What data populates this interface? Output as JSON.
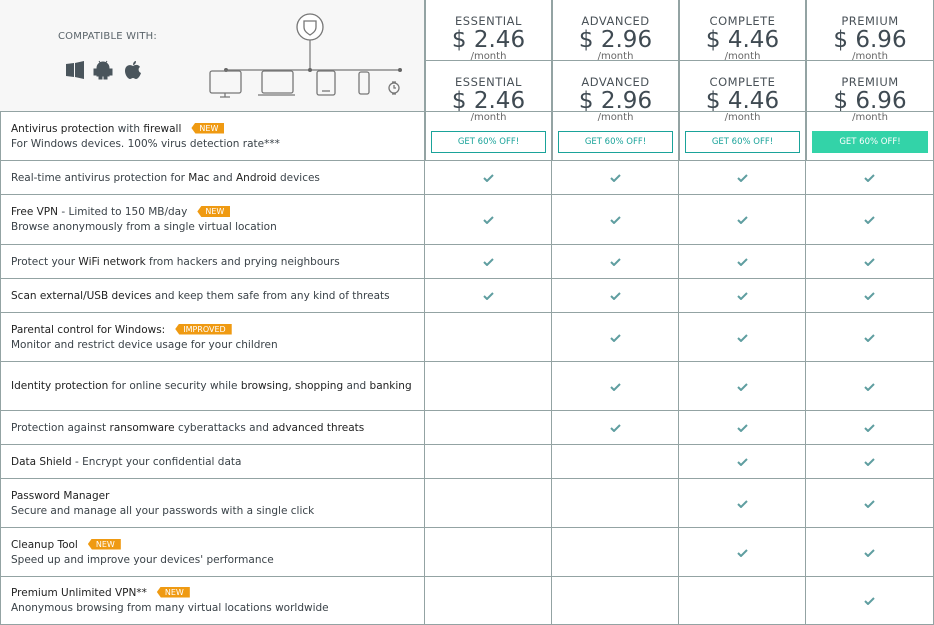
{
  "compatible_label": "COMPATIBLE WITH:",
  "os_icons": [
    "windows-icon",
    "android-icon",
    "apple-icon"
  ],
  "device_icons": [
    "desktop-icon",
    "laptop-icon",
    "tablet-icon",
    "phone-icon",
    "watch-icon"
  ],
  "colors": {
    "check": "#5f9ea0",
    "accent": "#1aa39a",
    "button_fill": "#33d3a8",
    "badge": "#ef9a12",
    "border": "#93a3a3"
  },
  "plans": [
    {
      "name": "ESSENTIAL",
      "price": "$ 2.46",
      "period": "/month",
      "button": "GET 60% OFF!",
      "highlight": false
    },
    {
      "name": "ADVANCED",
      "price": "$ 2.96",
      "period": "/month",
      "button": "GET 60% OFF!",
      "highlight": false
    },
    {
      "name": "COMPLETE",
      "price": "$ 4.46",
      "period": "/month",
      "button": "GET 60% OFF!",
      "highlight": false
    },
    {
      "name": "PREMIUM",
      "price": "$ 6.96",
      "period": "/month",
      "button": "GET 60% OFF!",
      "highlight": true
    }
  ],
  "features": [
    {
      "title": [
        [
          "b",
          "Antivirus protection"
        ],
        [
          "n",
          " with "
        ],
        [
          "b",
          "firewall"
        ]
      ],
      "badge": "NEW",
      "sub": "For Windows devices. 100% virus detection rate***",
      "checks": [
        false,
        false,
        false,
        false
      ]
    },
    {
      "title": [
        [
          "n",
          "Real-time antivirus protection for "
        ],
        [
          "b",
          "Mac"
        ],
        [
          "n",
          " and "
        ],
        [
          "b",
          "Android"
        ],
        [
          "n",
          " devices"
        ]
      ],
      "checks": [
        true,
        true,
        true,
        true
      ]
    },
    {
      "title": [
        [
          "b",
          "Free VPN"
        ],
        [
          "n",
          " - Limited to 150 MB/day"
        ]
      ],
      "badge": "NEW",
      "sub": "Browse anonymously from a single virtual location",
      "checks": [
        true,
        true,
        true,
        true
      ]
    },
    {
      "title": [
        [
          "n",
          "Protect your "
        ],
        [
          "b",
          "WiFi network"
        ],
        [
          "n",
          " from hackers and prying neighbours"
        ]
      ],
      "checks": [
        true,
        true,
        true,
        true
      ]
    },
    {
      "title": [
        [
          "b",
          "Scan external/USB devices"
        ],
        [
          "n",
          " and keep them safe from any kind of threats"
        ]
      ],
      "checks": [
        true,
        true,
        true,
        true
      ]
    },
    {
      "title": [
        [
          "b",
          "Parental control for Windows:"
        ]
      ],
      "badge": "IMPROVED",
      "sub": "Monitor and restrict device usage for your children",
      "checks": [
        false,
        true,
        true,
        true
      ]
    },
    {
      "title": [
        [
          "b",
          "Identity protection"
        ],
        [
          "n",
          " for online security while "
        ],
        [
          "b",
          "browsing, shopping"
        ],
        [
          "n",
          " and "
        ],
        [
          "b",
          "banking"
        ]
      ],
      "checks": [
        false,
        true,
        true,
        true
      ]
    },
    {
      "title": [
        [
          "n",
          "Protection against "
        ],
        [
          "b",
          "ransomware"
        ],
        [
          "n",
          " cyberattacks and "
        ],
        [
          "b",
          "advanced threats"
        ]
      ],
      "checks": [
        false,
        true,
        true,
        true
      ]
    },
    {
      "title": [
        [
          "b",
          "Data Shield"
        ],
        [
          "n",
          " - Encrypt your confidential data"
        ]
      ],
      "checks": [
        false,
        false,
        true,
        true
      ]
    },
    {
      "title": [
        [
          "b",
          "Password Manager"
        ]
      ],
      "sub": "Secure and manage all your passwords with a single click",
      "checks": [
        false,
        false,
        true,
        true
      ]
    },
    {
      "title": [
        [
          "b",
          "Cleanup Tool"
        ]
      ],
      "badge": "NEW",
      "sub": "Speed up and improve your devices' performance",
      "checks": [
        false,
        false,
        true,
        true
      ]
    },
    {
      "title": [
        [
          "b",
          "Premium Unlimited VPN**"
        ]
      ],
      "badge": "NEW",
      "sub": "Anonymous browsing from many virtual locations worldwide",
      "checks": [
        false,
        false,
        false,
        true
      ]
    }
  ]
}
